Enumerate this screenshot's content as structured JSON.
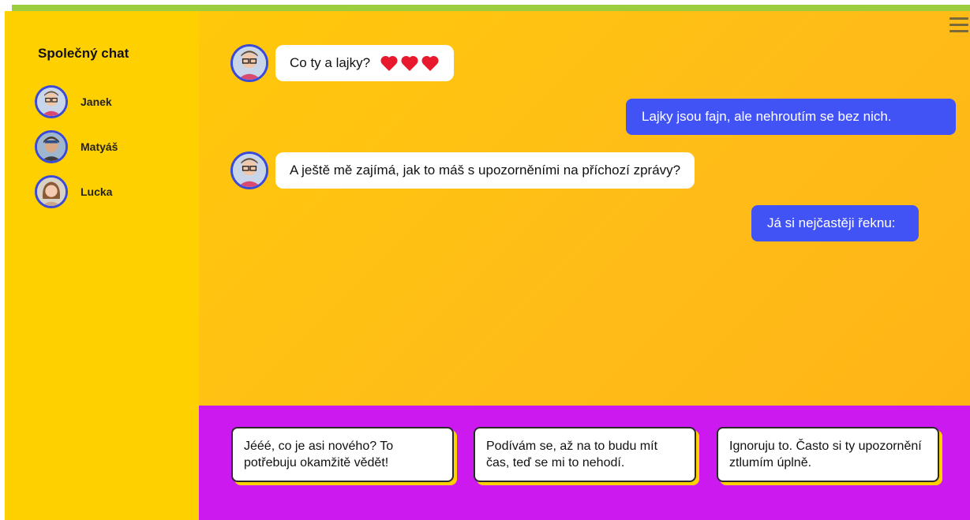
{
  "sidebar": {
    "title": "Společný chat",
    "contacts": [
      {
        "name": "Janek",
        "avatar": "avatar-janek"
      },
      {
        "name": "Matyáš",
        "avatar": "avatar-matyas"
      },
      {
        "name": "Lucka",
        "avatar": "avatar-lucka"
      }
    ]
  },
  "chat": {
    "menu_icon": "hamburger-menu-icon",
    "messages": [
      {
        "from": "Janek",
        "direction": "incoming",
        "text": "Co ty a lajky?",
        "hearts": 3
      },
      {
        "direction": "outgoing",
        "text": "Lajky jsou fajn, ale nehroutím se bez nich."
      },
      {
        "from": "Janek",
        "direction": "incoming",
        "text": "A ještě mě zajímá, jak to máš s upozorněními na příchozí zprávy?"
      },
      {
        "direction": "outgoing",
        "text": "Já si nejčastěji řeknu:"
      }
    ]
  },
  "answers": [
    "Jééé, co je asi nového? To potřebuju okamžitě vědět!",
    "Podívám se, až na to budu mít čas, teď se mi to nehodí.",
    "Ignoruju to. Často si ty upozornění ztlumím úplně."
  ],
  "colors": {
    "sidebar": "#ffd000",
    "chat_background": "#ffc010",
    "outgoing_bubble": "#4253f5",
    "answers_panel": "#cc19f0",
    "top_bar": "#9ccd3f",
    "heart": "#e8192c"
  }
}
